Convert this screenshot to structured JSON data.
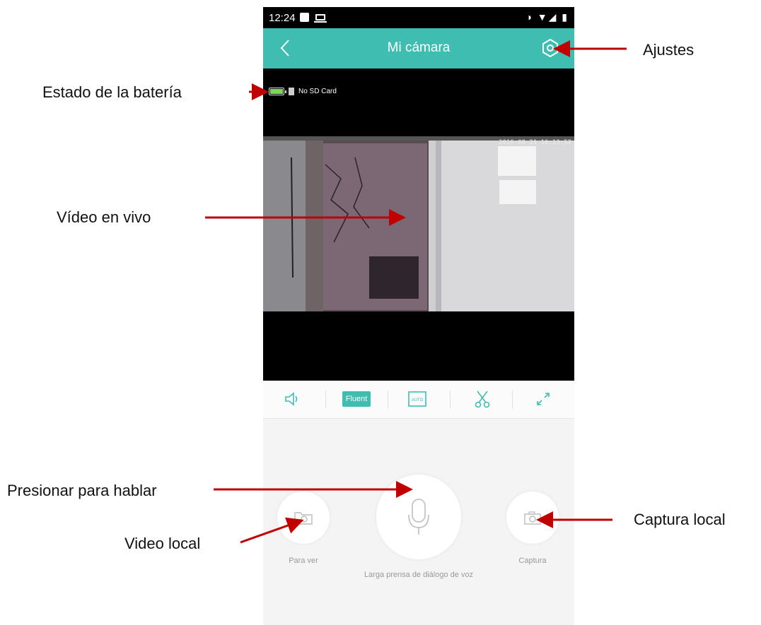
{
  "status_bar": {
    "time": "12:24",
    "right_icons": "◑ ▼◢ ▮"
  },
  "app_bar": {
    "title": "Mi cámara"
  },
  "video": {
    "sd_status": "No SD Card",
    "battery_level": 1.0,
    "timestamp": "2016-08-21 16:13:52"
  },
  "toolbar": {
    "fluent_label": "Fluent",
    "auto_label": "AUTO"
  },
  "controls": {
    "left_label": "Para ver",
    "center_label": "Larga prensa de diálogo de voz",
    "right_label": "Captura"
  },
  "annotations": {
    "ajustes": "Ajustes",
    "bateria": "Estado de la batería",
    "video_en_vivo": "Vídeo en vivo",
    "presionar": "Presionar para hablar",
    "video_local": "Video local",
    "captura_local": "Captura local"
  },
  "colors": {
    "accent": "#3fbdb0",
    "arrow": "#c00000",
    "battery": "#7ed957"
  }
}
